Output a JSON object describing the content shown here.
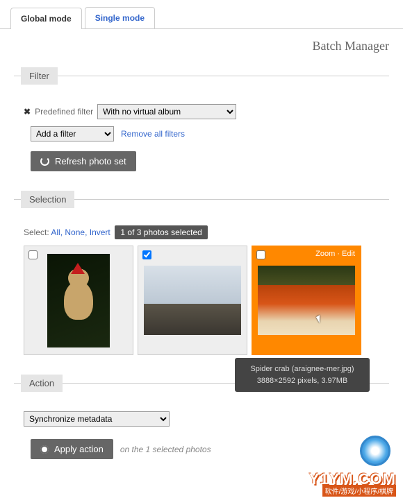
{
  "tabs": {
    "global": "Global mode",
    "single": "Single mode"
  },
  "page_title": "Batch Manager",
  "filter": {
    "legend": "Filter",
    "predefined_label": "Predefined filter",
    "predefined_value": "With no virtual album",
    "add_filter": "Add a filter",
    "remove_all": "Remove all filters",
    "refresh": "Refresh photo set"
  },
  "selection": {
    "legend": "Selection",
    "select_label": "Select:",
    "all": "All",
    "none": "None",
    "invert": "Invert",
    "count": "1 of 3 photos selected"
  },
  "thumbs": {
    "zoom": "Zoom",
    "edit": "Edit",
    "sep": " · "
  },
  "tooltip": {
    "line1": "Spider crab (araignee-mer.jpg)",
    "line2": "3888×2592 pixels, 3.97MB"
  },
  "action": {
    "legend": "Action",
    "select_value": "Synchronize metadata",
    "apply": "Apply action",
    "info": "on the 1 selected photos"
  },
  "watermark": {
    "brand": "Y1YM.COM",
    "sub": "软件/游戏/小程序/棋牌"
  }
}
